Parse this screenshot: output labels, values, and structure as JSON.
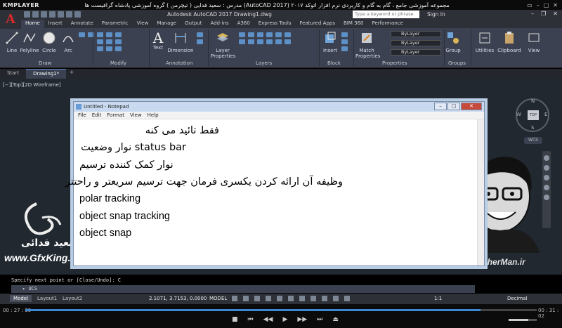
{
  "player": {
    "logo": "KMPLAYER",
    "window_title": "مجموعه آموزشی جامع ، گام به گام و کاربردی نرم افزار اتوکد ۲۰۱۷ (AutoCAD 2017) مدرس : سعید فدایی ( تیچرمن ) گروه آموزشی پادشاه گرافیست ها",
    "time_elapsed": "00 : 27 : 39",
    "time_total": "00 : 31 : 02",
    "progress": 0.89,
    "volume": 0.7
  },
  "autocad": {
    "app_title": "Autodesk AutoCAD 2017    Drawing1.dwg",
    "search_placeholder": "Type a keyword or phrase",
    "sign_in": "Sign In",
    "ribbon_tabs": [
      "Home",
      "Insert",
      "Annotate",
      "Parametric",
      "View",
      "Manage",
      "Output",
      "Add-ins",
      "A360",
      "Express Tools",
      "Featured Apps",
      "BIM 360",
      "Performance"
    ],
    "ribbon": {
      "line": "Line",
      "polyline": "Polyline",
      "circle": "Circle",
      "arc": "Arc",
      "text": "Text",
      "dimension": "Dimension",
      "layer_properties": "Layer Properties",
      "insert": "Insert",
      "match_properties": "Match Properties",
      "group": "Group",
      "utilities": "Utilities",
      "clipboard": "Clipboard",
      "view": "View",
      "bylayer_1": "ByLayer",
      "bylayer_2": "ByLayer",
      "bylayer_3": "ByLayer",
      "panel_draw": "Draw",
      "panel_modify": "Modify",
      "panel_annotation": "Annotation",
      "panel_layers": "Layers",
      "panel_block": "Block",
      "panel_properties": "Properties",
      "panel_groups": "Groups"
    },
    "file_tabs": [
      "Start",
      "Drawing1*"
    ],
    "viewport_label": "[−][Top][2D Wireframe]",
    "viewcube": {
      "top": "TOP",
      "n": "N",
      "s": "S",
      "e": "E",
      "w": "W",
      "wcs": "WCS"
    },
    "command_history": "Specify next point or [Close/Undo]: C",
    "command_input": "UCS",
    "layout_tabs": [
      "Model",
      "Layout1",
      "Layout2"
    ],
    "coords": "2.1071, 3.7153, 0.0000",
    "model_label": "MODEL",
    "scale": "1:1",
    "units": "Decimal"
  },
  "notepad": {
    "title": "Untitled - Notepad",
    "menu": [
      "File",
      "Edit",
      "Format",
      "View",
      "Help"
    ],
    "lines": [
      "فقط تائید می کنه",
      "status bar  نوار وضعیت",
      "نوار کمک کننده ترسیم",
      "وظیفه آن ارائه کردن یکسری فرمان جهت ترسیم سریعتر و راحتتر",
      "polar tracking",
      "object snap tracking",
      "object snap"
    ]
  },
  "watermark": {
    "author_name": "سعید فدائی",
    "site_left": "www.GfxKing.i",
    "site_right": "www.TeacherMan.ir"
  },
  "colors": {
    "accent": "#3d86d1",
    "ribbon_bg": "#3b4150",
    "drawing_bg": "#212830"
  }
}
